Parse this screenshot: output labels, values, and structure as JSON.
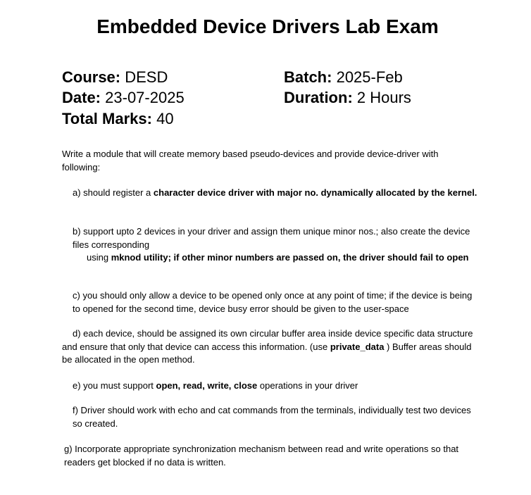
{
  "title": "Embedded Device Drivers Lab Exam",
  "meta": {
    "course_label": "Course:",
    "course_value": "DESD",
    "batch_label": "Batch:",
    "batch_value": "2025-Feb",
    "date_label": "Date:",
    "date_value": "23-07-2025",
    "duration_label": "Duration:",
    "duration_value": "2 Hours",
    "marks_label": "Total Marks:",
    "marks_value": "40"
  },
  "intro": "Write a module that will create memory based pseudo-devices and provide device-driver with following:",
  "items": {
    "a": {
      "t1": "a)  should register a ",
      "b1": "character device driver with major no. dynamically allocated by the kernel."
    },
    "b": {
      "t1": "b) support upto 2 devices in your driver and assign them unique minor nos.; also create the device files corresponding",
      "t2": "using ",
      "b1": "mknod utility; if other minor numbers are passed on, the driver should fail to open"
    },
    "c": {
      "t1": "c)  you should only allow a device to be opened only once at any point of time; if the device is being to opened for the second time, device busy error should be given to the user-space"
    },
    "d": {
      "t1": "d) each device, should be assigned its own circular buffer area inside device specific data structure and ensure that only that device can access this information. (use ",
      "b1": "private_data",
      "t2": " ) Buffer areas should be allocated in the open method."
    },
    "e": {
      "t1": "e) you must support ",
      "b1": "open, read, write, close",
      "t2": " operations in your driver"
    },
    "f": {
      "t1": "f) Driver should work with echo and cat commands from the terminals, individually test two devices so created."
    },
    "g": {
      "t1": "g) Incorporate appropriate synchronization mechanism between read and write operations so that readers get blocked if no data is written."
    }
  }
}
